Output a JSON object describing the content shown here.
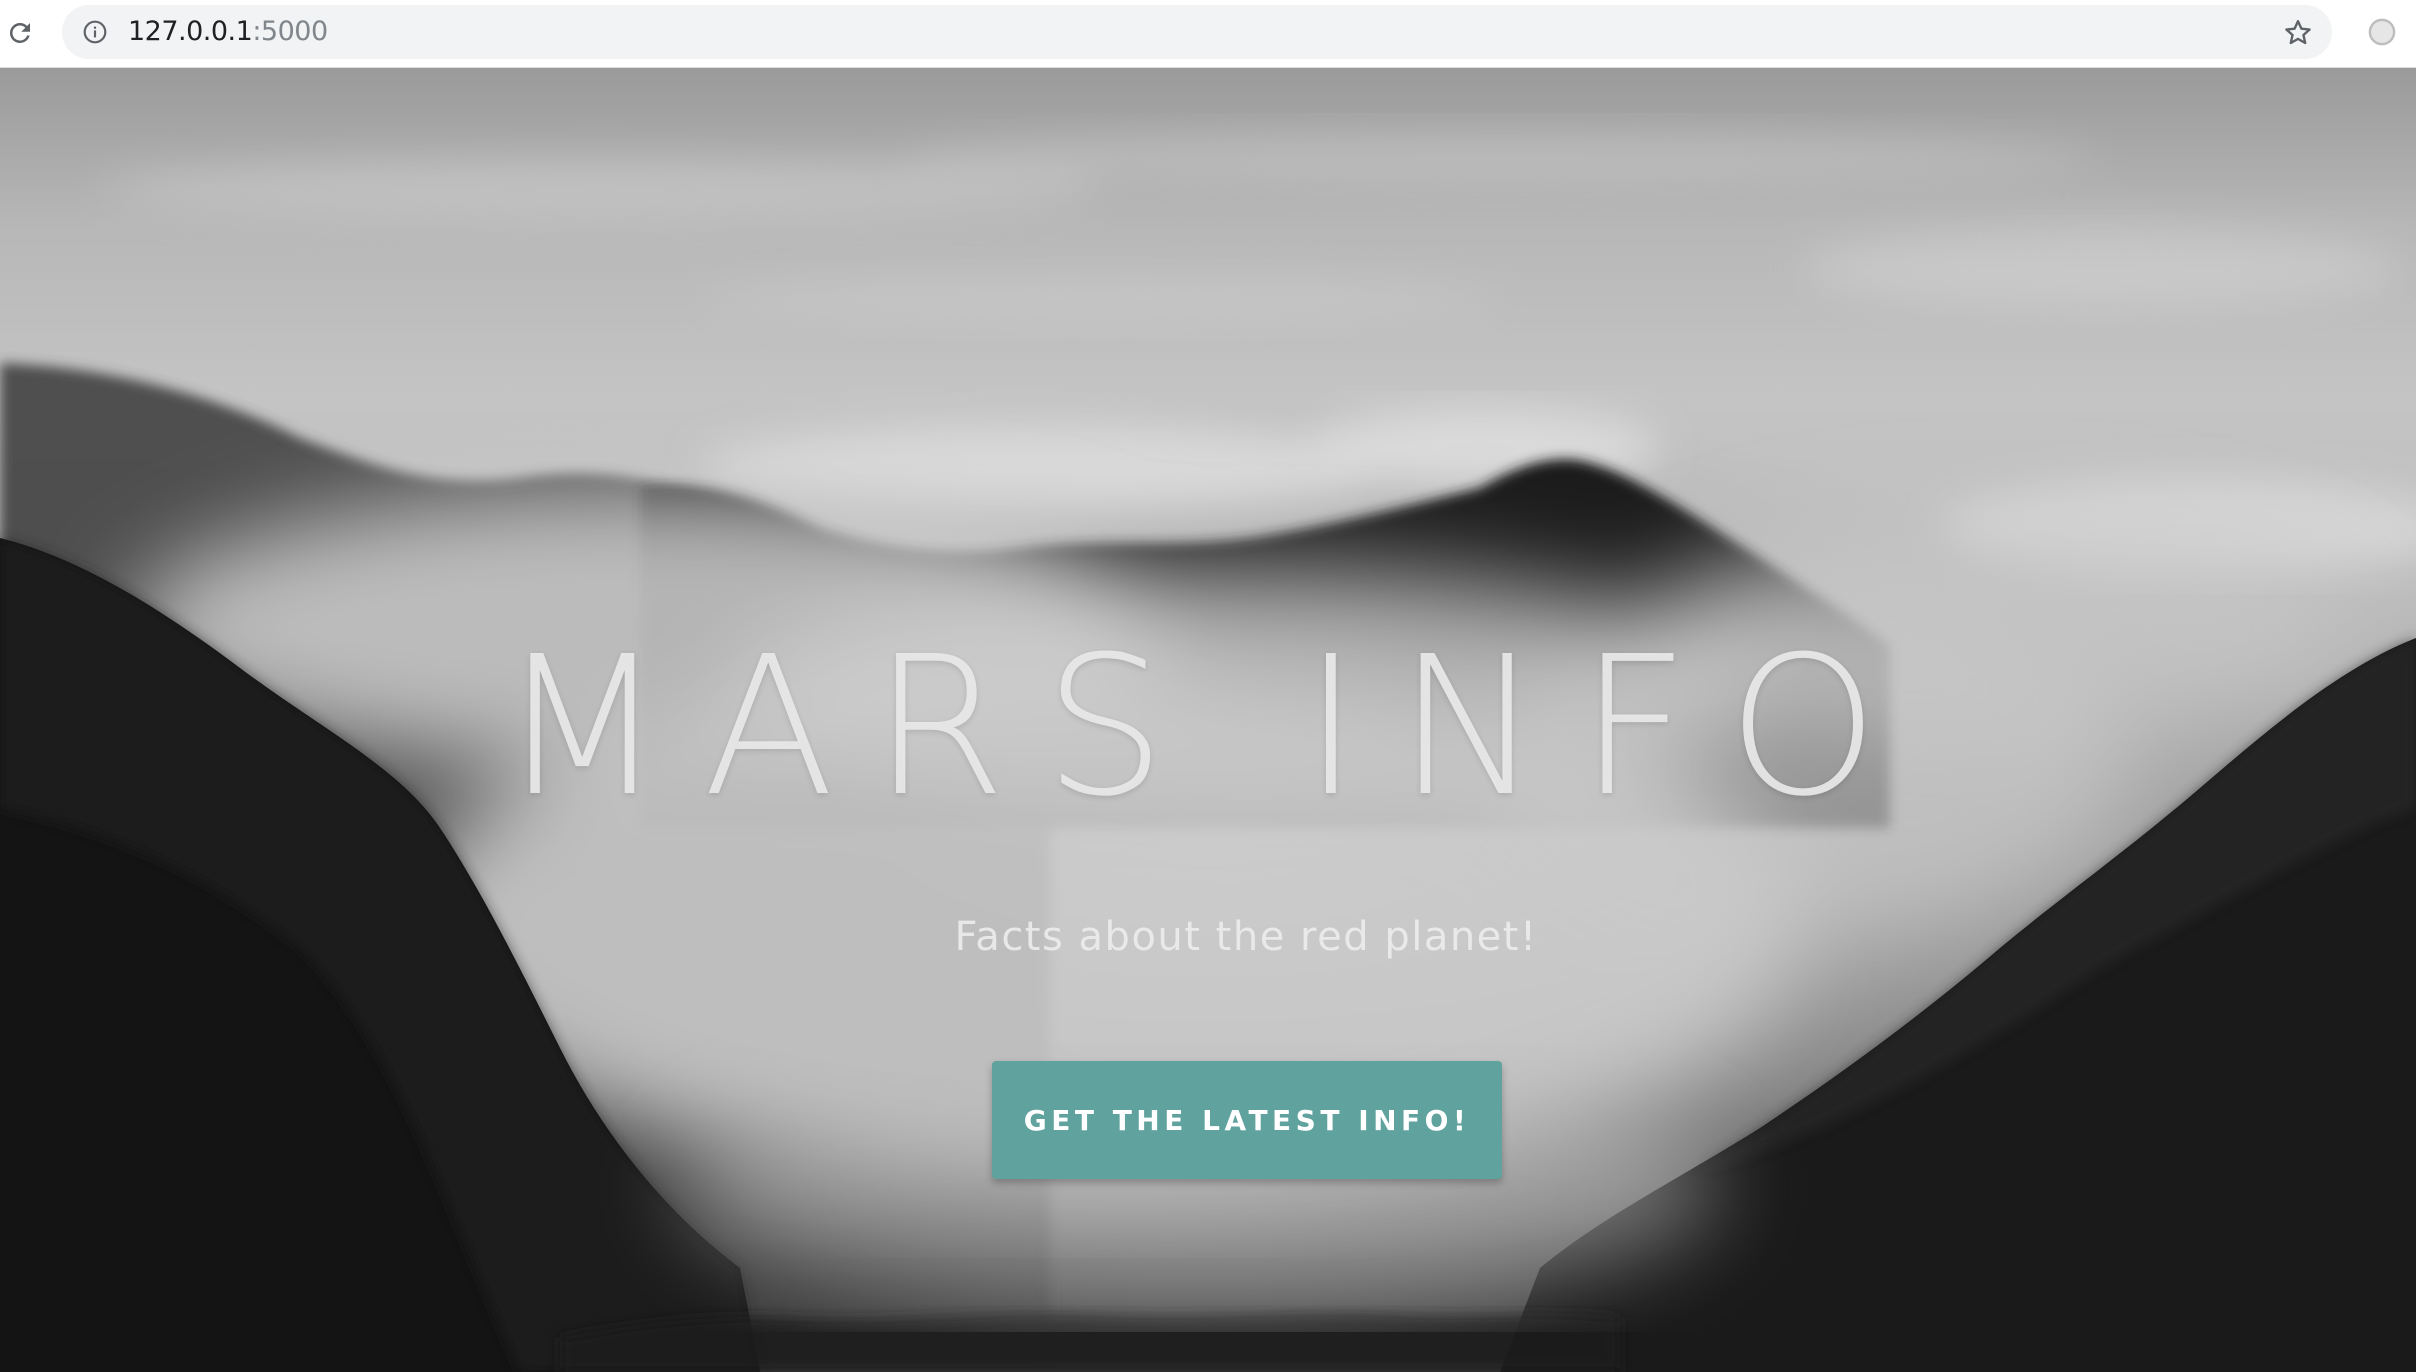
{
  "browser": {
    "url_host": "127.0.0.1",
    "url_port": ":5000"
  },
  "hero": {
    "title": "MARS INFO",
    "subtitle": "Facts about the red planet!",
    "cta_label": "GET THE LATEST INFO!"
  },
  "colors": {
    "button_bg": "#5fa29e",
    "button_text": "#ffffff",
    "omnibox_bg": "#f1f3f4"
  },
  "icons": {
    "reload": "reload-icon",
    "site_info": "info-icon",
    "bookmark": "star-icon",
    "profile": "profile-icon"
  }
}
